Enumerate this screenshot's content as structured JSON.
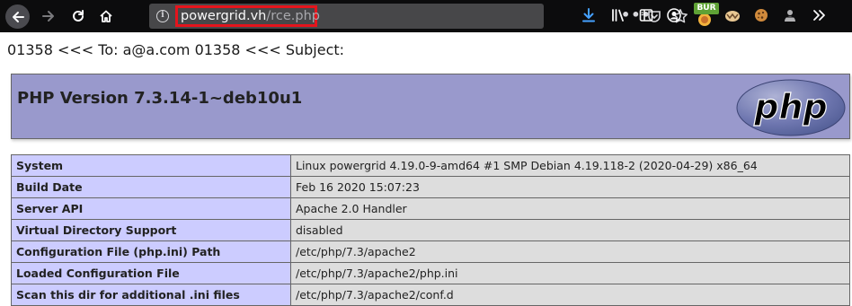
{
  "browser": {
    "url_host": "powergrid.vh",
    "url_path": "/rce.php",
    "page_actions_label": "•••",
    "extension_badge": "BUR",
    "icons": [
      "back-icon",
      "forward-icon",
      "reload-icon",
      "home-icon",
      "info-icon",
      "page-actions-icon",
      "pocket-icon",
      "bookmark-star-icon",
      "download-icon",
      "library-icon",
      "sidebar-icon",
      "account-icon",
      "burp-extension-icon",
      "cookie-editor-icon",
      "cookie-icon",
      "incognito-icon",
      "overflow-menu-icon"
    ],
    "colors": {
      "toolbar": "#0c0c0d",
      "urlbar": "#474749",
      "highlight": "#e5141c",
      "download_accent": "#45a1ff"
    }
  },
  "page": {
    "mail_line": "01358 <<< To: a@a.com 01358 <<< Subject:",
    "php_version_title": "PHP Version 7.3.14-1~deb10u1",
    "logo_text": "php",
    "colors": {
      "header": "#9999cc",
      "key_cell": "#ccccff",
      "value_cell": "#dddddd"
    },
    "rows": [
      {
        "key": "System",
        "value": "Linux powergrid 4.19.0-9-amd64 #1 SMP Debian 4.19.118-2 (2020-04-29) x86_64"
      },
      {
        "key": "Build Date",
        "value": "Feb 16 2020 15:07:23"
      },
      {
        "key": "Server API",
        "value": "Apache 2.0 Handler"
      },
      {
        "key": "Virtual Directory Support",
        "value": "disabled"
      },
      {
        "key": "Configuration File (php.ini) Path",
        "value": "/etc/php/7.3/apache2"
      },
      {
        "key": "Loaded Configuration File",
        "value": "/etc/php/7.3/apache2/php.ini"
      },
      {
        "key": "Scan this dir for additional .ini files",
        "value": "/etc/php/7.3/apache2/conf.d"
      }
    ]
  }
}
